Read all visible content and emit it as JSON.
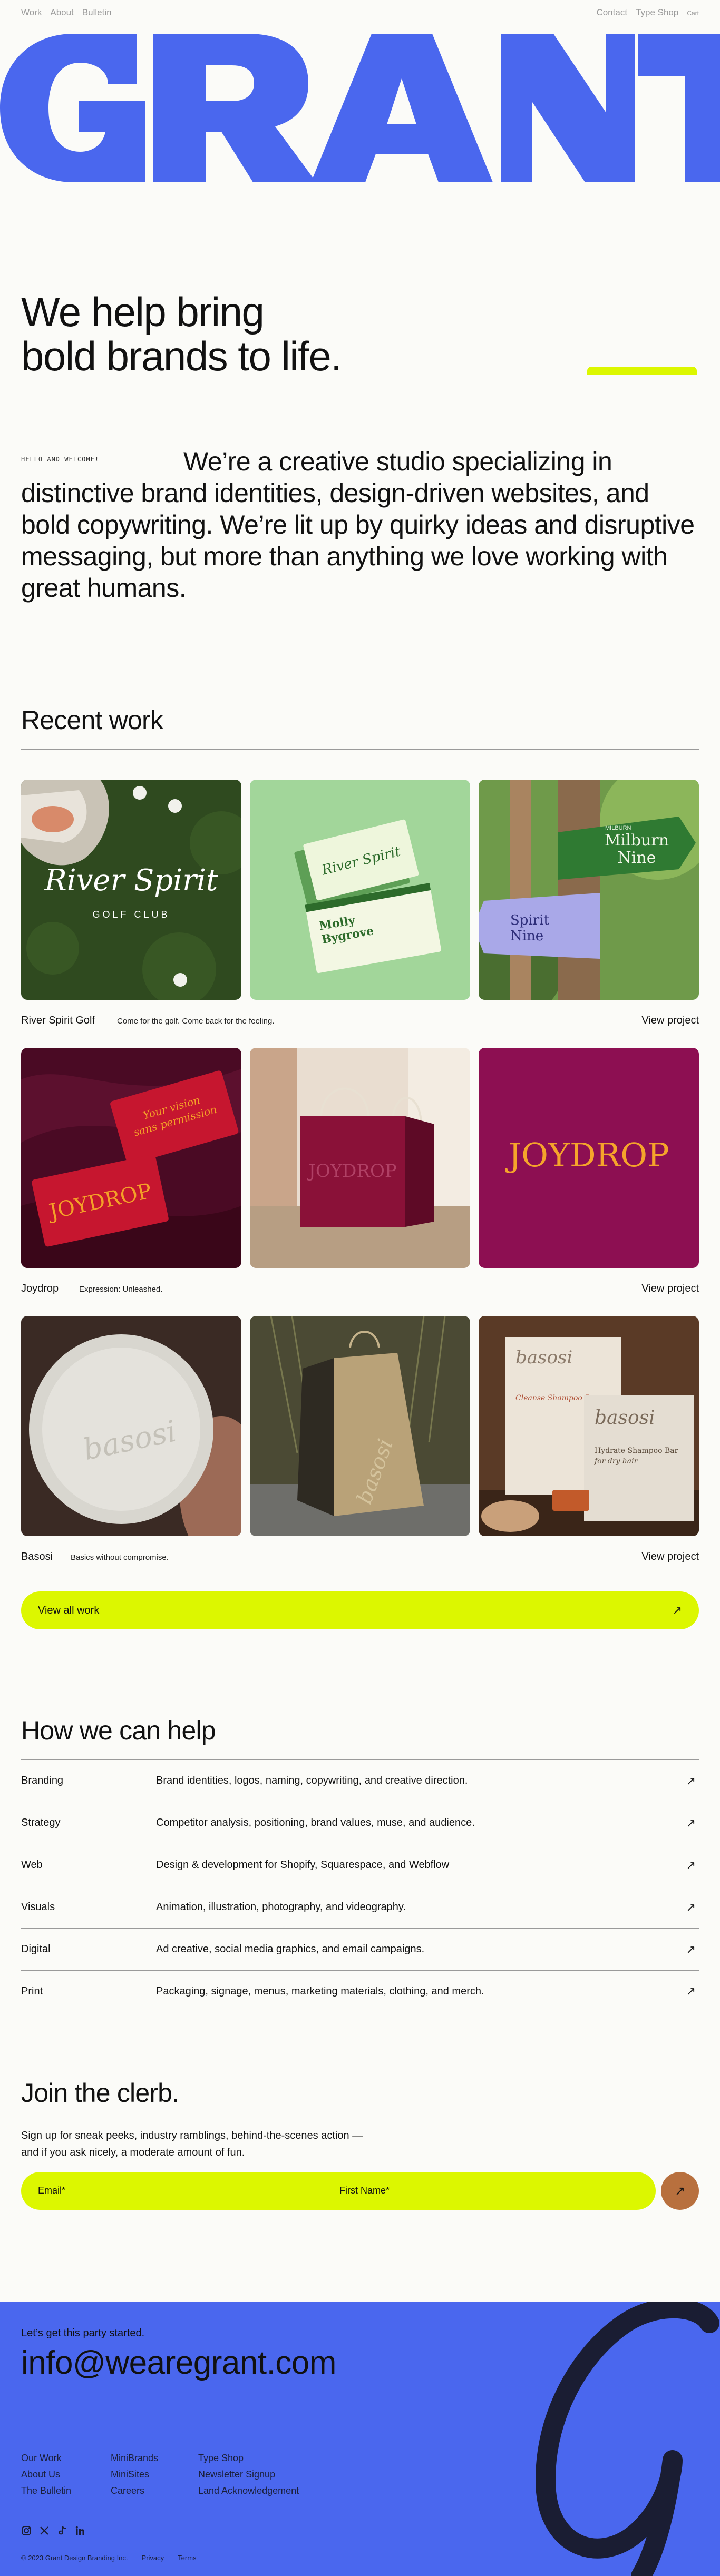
{
  "nav": {
    "left": [
      "Work",
      "About",
      "Bulletin"
    ],
    "right": [
      "Contact",
      "Type Shop"
    ],
    "cart": "Cart"
  },
  "brand": {
    "wordmark": "GRANT",
    "color": "#4a67ee",
    "accent": "#dcf700"
  },
  "hero": {
    "line1": "We help bring",
    "line2": "bold brands to life."
  },
  "intro": {
    "label": "HELLO AND WELCOME!",
    "text": "We’re a creative studio specializing in distinctive brand identities, design-driven websites, and bold copywriting. We’re lit up by quirky ideas and disruptive messaging, but more than anything we love working with great humans."
  },
  "recent": {
    "title": "Recent work",
    "view_label": "View project",
    "projects": [
      {
        "name": "River Spirit Golf",
        "tagline": "Come for the golf. Come back for the feeling.",
        "images": [
          {
            "title": "River Spirit",
            "subtitle": "GOLF CLUB"
          },
          {
            "card_brand": "River Spirit",
            "card_name1": "Molly",
            "card_name2": "Bygrove"
          },
          {
            "sign_top_small": "MILBURN",
            "sign_top_big1": "Milburn",
            "sign_top_big2": "Nine",
            "sign_bottom1": "Spirit",
            "sign_bottom2": "Nine"
          }
        ]
      },
      {
        "name": "Joydrop",
        "tagline": "Expression: Unleashed.",
        "images": [
          {
            "card1": "JOYDROP",
            "card2a": "Your vision",
            "card2b": "sans permission"
          },
          {
            "bag": "JOYDROP"
          },
          {
            "logo": "JOYDROP"
          }
        ]
      },
      {
        "name": "Basosi",
        "tagline": "Basics without compromise.",
        "images": [
          {
            "soap": "basosi"
          },
          {
            "bag": "basosi"
          },
          {
            "box1": "basosi",
            "box1_sub": "Cleanse Shampoo Bar",
            "box2": "basosi",
            "box2_sub1": "Hydrate Shampoo Bar",
            "box2_sub2": "for dry hair"
          }
        ]
      }
    ],
    "view_all": "View all work"
  },
  "services": {
    "title": "How we can help",
    "items": [
      {
        "name": "Branding",
        "desc": "Brand identities, logos, naming, copywriting, and creative direction."
      },
      {
        "name": "Strategy",
        "desc": "Competitor analysis, positioning, brand values, muse, and audience."
      },
      {
        "name": "Web",
        "desc": "Design & development for Shopify, Squarespace, and Webflow"
      },
      {
        "name": "Visuals",
        "desc": "Animation, illustration, photography, and videography."
      },
      {
        "name": "Digital",
        "desc": "Ad creative, social media graphics, and email campaigns."
      },
      {
        "name": "Print",
        "desc": "Packaging, signage, menus, marketing materials, clothing, and merch."
      }
    ]
  },
  "newsletter": {
    "title": "Join the clerb.",
    "text": "Sign up for sneak peeks, industry ramblings, behind-the-scenes action — and if you ask nicely, a moderate amount of fun.",
    "email_label": "Email*",
    "first_name_label": "First Name*"
  },
  "footer": {
    "cta": "Let’s get this party started.",
    "email": "info@wearegrant.com",
    "col1": [
      "Our Work",
      "About Us",
      "The Bulletin"
    ],
    "col2": [
      "MiniBrands",
      "MiniSites",
      "Careers"
    ],
    "col3": [
      "Type Shop",
      "Newsletter Signup",
      "Land Acknowledgement"
    ],
    "social": [
      "instagram-icon",
      "x-icon",
      "tiktok-icon",
      "linkedin-icon"
    ],
    "copyright": "© 2023 Grant Design Branding Inc.",
    "privacy": "Privacy",
    "terms": "Terms"
  }
}
